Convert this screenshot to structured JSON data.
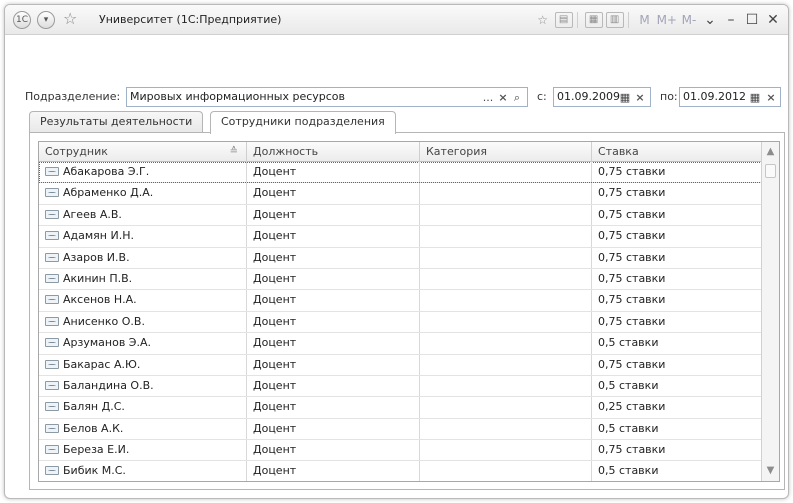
{
  "window": {
    "title": "Университет (1С:Предприятие)",
    "logo": "1C",
    "toolbar_icons": [
      "star-icon",
      "print-icon",
      "calculator-icon",
      "calendar-icon"
    ],
    "memory": [
      "M",
      "M+",
      "M-"
    ]
  },
  "filter": {
    "division_label": "Подразделение:",
    "division_value": "Мировых информационных ресурсов",
    "from_label": "с:",
    "from_value": "01.09.2009",
    "to_label": "по:",
    "to_value": "01.09.2012",
    "ellipsis": "...",
    "clear": "×",
    "search": "🔍"
  },
  "tabs": [
    {
      "label": "Результаты деятельности",
      "active": false
    },
    {
      "label": "Сотрудники подразделения",
      "active": true
    }
  ],
  "table": {
    "columns": [
      "Сотрудник",
      "Должность",
      "Категория",
      "Ставка"
    ],
    "rows": [
      [
        "Абакарова Э.Г.",
        "Доцент",
        "",
        "0,75 ставки"
      ],
      [
        "Абраменко Д.А.",
        "Доцент",
        "",
        "0,75 ставки"
      ],
      [
        "Агеев А.В.",
        "Доцент",
        "",
        "0,75 ставки"
      ],
      [
        "Адамян И.Н.",
        "Доцент",
        "",
        "0,75 ставки"
      ],
      [
        "Азаров И.В.",
        "Доцент",
        "",
        "0,75 ставки"
      ],
      [
        "Акинин П.В.",
        "Доцент",
        "",
        "0,75 ставки"
      ],
      [
        "Аксенов Н.А.",
        "Доцент",
        "",
        "0,75 ставки"
      ],
      [
        "Анисенко О.В.",
        "Доцент",
        "",
        "0,75 ставки"
      ],
      [
        "Арзуманов Э.А.",
        "Доцент",
        "",
        "0,5 ставки"
      ],
      [
        "Бакарас А.Ю.",
        "Доцент",
        "",
        "0,75 ставки"
      ],
      [
        "Баландина О.В.",
        "Доцент",
        "",
        "0,5 ставки"
      ],
      [
        "Балян Д.С.",
        "Доцент",
        "",
        "0,25 ставки"
      ],
      [
        "Белов А.К.",
        "Доцент",
        "",
        "0,5 ставки"
      ],
      [
        "Береза Е.И.",
        "Доцент",
        "",
        "0,75 ставки"
      ],
      [
        "Бибик М.С.",
        "Доцент",
        "",
        "0,5 ставки"
      ]
    ]
  }
}
